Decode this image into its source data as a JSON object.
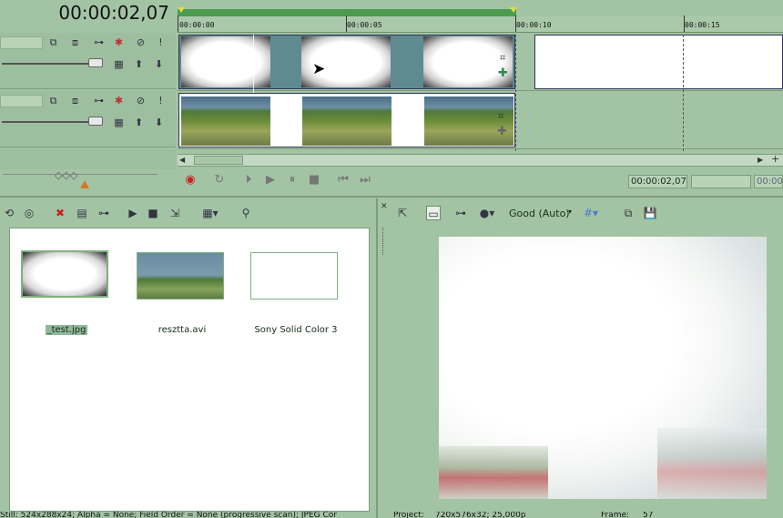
{
  "timecode": "00:00:02,07",
  "ruler": {
    "labels": [
      "00:00:00",
      "00:00:05",
      "00:00:10",
      "00:00:15"
    ]
  },
  "track_icons": {
    "row1": [
      "bypass-fx-icon",
      "track-motion-icon",
      "compositing-icon",
      "track-fx-icon",
      "mute-icon",
      "solo-icon"
    ],
    "row2": [
      "bypass-fx-icon",
      "track-motion-icon",
      "compositing-icon",
      "track-fx-icon",
      "mute-icon",
      "solo-icon"
    ]
  },
  "transport": {
    "time_display": "00:00:02,07",
    "time_display_2": "",
    "time_display_3": "00:00"
  },
  "media": {
    "items": [
      {
        "label": "_test.jpg",
        "selected": true
      },
      {
        "label": "resztta.avi",
        "selected": false
      },
      {
        "label": "Sony Solid Color 3",
        "selected": false
      }
    ]
  },
  "preview": {
    "quality": "Good (Auto)"
  },
  "status": {
    "left": "Still: 524x288x24; Alpha = None; Field Order = None (progressive scan); JPEG Cor",
    "project": "Project:",
    "project_value": "720x576x32; 25,000p",
    "frame": "Frame:",
    "frame_value": "57"
  },
  "colors": {
    "background": "#a3c4a4",
    "ruler_bar": "#4c9b4f"
  }
}
